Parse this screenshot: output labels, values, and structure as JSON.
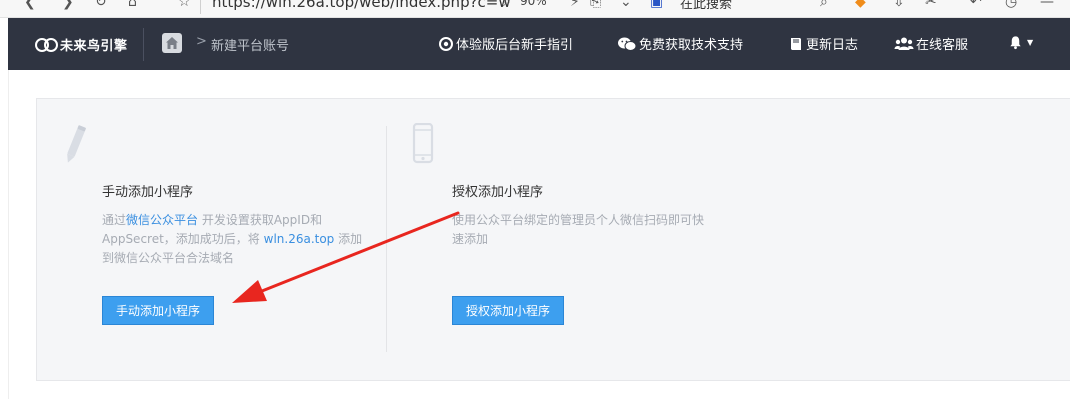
{
  "browser": {
    "url": "https://wln.26a.top/web/index.php?c=w",
    "zoom": "90%",
    "search_label": "在此搜索"
  },
  "header": {
    "logo_text": "未来鸟引擎",
    "breadcrumb_current": "新建平台账号",
    "breadcrumb_separator": ">",
    "nav_items": [
      {
        "label": "体验版后台新手指引",
        "icon": "circle-dot-icon"
      },
      {
        "label": "免费获取技术支持",
        "icon": "wechat-icon"
      },
      {
        "label": "更新日志",
        "icon": "book-icon"
      },
      {
        "label": "在线客服",
        "icon": "users-icon"
      }
    ],
    "bell_caret": "▼"
  },
  "cards": {
    "manual": {
      "title": "手动添加小程序",
      "desc_prefix": "通过",
      "desc_link1": "微信公众平台",
      "desc_middle": " 开发设置获取AppID和AppSecret，添加成功后，将 ",
      "desc_link2": "wln.26a.top",
      "desc_suffix": " 添加到微信公众平台合法域名",
      "button_label": "手动添加小程序",
      "icon": "pencil-icon"
    },
    "authorize": {
      "title": "授权添加小程序",
      "desc": "使用公众平台绑定的管理员个人微信扫码即可快速添加",
      "button_label": "授权添加小程序",
      "icon": "phone-icon"
    }
  },
  "colors": {
    "header_bg": "#2f3441",
    "panel_bg": "#f5f6f8",
    "button_bg": "#3d9fef",
    "link": "#3a8fe0",
    "annotation_arrow": "#e8261f"
  }
}
